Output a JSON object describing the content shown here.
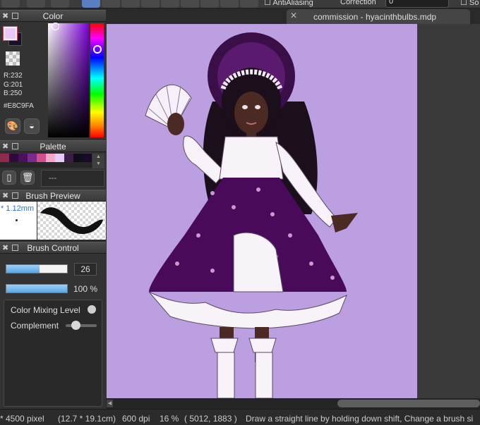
{
  "toolbar": {
    "antialiasing_label": "AntiAliasing",
    "correction_label": "Correction",
    "correction_value": "0",
    "clipped_label": "So"
  },
  "color_panel": {
    "title": "Color",
    "rgb": {
      "r": "R:232",
      "g": "G:201",
      "b": "B:250"
    },
    "hex": "#E8C9FA",
    "foreground_color": "#E8C9FA",
    "background_color": "#1A0F2A"
  },
  "palette_panel": {
    "title": "Palette",
    "swatches": [
      "#8e2a50",
      "#2c0a3a",
      "#4a1060",
      "#7a2a8a",
      "#d14f8f",
      "#f6a6c6",
      "#e8c9fa",
      "#3b1a4c",
      "#0e0e1a",
      "#1a0a2a"
    ],
    "name_value": "---"
  },
  "brush_preview_panel": {
    "title": "Brush Preview",
    "size_value": "* 1.12mm"
  },
  "brush_control_panel": {
    "title": "Brush Control",
    "size_value": "26",
    "size_fraction": 0.55,
    "opacity_value": "100 %",
    "opacity_fraction": 1.0,
    "color_mixing_label": "Color Mixing Level",
    "complement_label": "Complement"
  },
  "document": {
    "tab_title": "commission - hyacinthbulbs.mdp",
    "canvas_color": "#BB9FE0"
  },
  "statusbar": {
    "size_pixels": "* 4500 pixel",
    "size_cm": "(12.7 * 19.1cm)",
    "dpi": "600 dpi",
    "zoom": "16 %",
    "cursor": "( 5012, 1883 )",
    "hint": "Draw a straight line by holding down shift, Change a brush si"
  }
}
